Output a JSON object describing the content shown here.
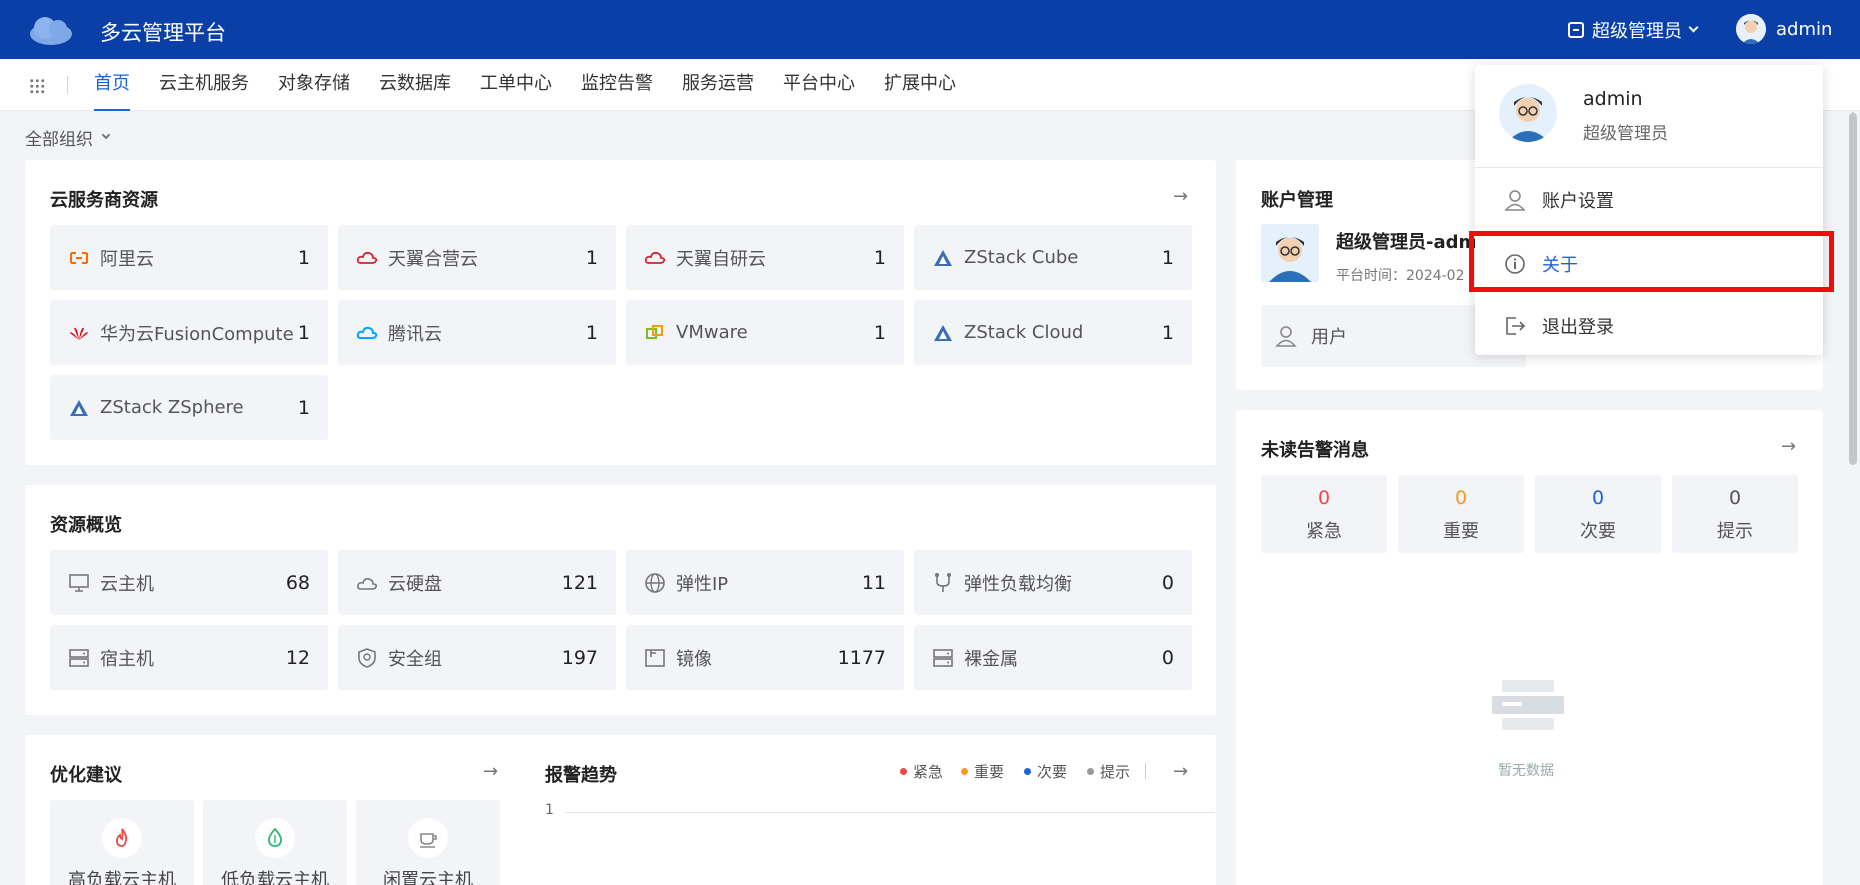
{
  "header": {
    "app_title": "多云管理平台",
    "role_label": "超级管理员",
    "username": "admin"
  },
  "nav": {
    "items": [
      "首页",
      "云主机服务",
      "对象存储",
      "云数据库",
      "工单中心",
      "监控告警",
      "服务运营",
      "平台中心",
      "扩展中心"
    ],
    "active_index": 0
  },
  "org_filter": {
    "label": "全部组织"
  },
  "cloud_resources": {
    "title": "云服务商资源",
    "items": [
      {
        "label": "阿里云",
        "value": "1",
        "icon": "aliyun-icon"
      },
      {
        "label": "天翼合营云",
        "value": "1",
        "icon": "tianyi-cloud-icon"
      },
      {
        "label": "天翼自研云",
        "value": "1",
        "icon": "tianyi-cloud-icon"
      },
      {
        "label": "ZStack Cube",
        "value": "1",
        "icon": "zstack-icon"
      },
      {
        "label": "华为云FusionCompute",
        "value": "1",
        "icon": "huawei-icon"
      },
      {
        "label": "腾讯云",
        "value": "1",
        "icon": "tencent-cloud-icon"
      },
      {
        "label": "VMware",
        "value": "1",
        "icon": "vmware-icon"
      },
      {
        "label": "ZStack Cloud",
        "value": "1",
        "icon": "zstack-icon"
      },
      {
        "label": "ZStack ZSphere",
        "value": "1",
        "icon": "zstack-icon"
      }
    ]
  },
  "resource_overview": {
    "title": "资源概览",
    "items": [
      {
        "label": "云主机",
        "value": "68",
        "icon": "monitor-icon"
      },
      {
        "label": "云硬盘",
        "value": "121",
        "icon": "cloud-disk-icon"
      },
      {
        "label": "弹性IP",
        "value": "11",
        "icon": "globe-icon"
      },
      {
        "label": "弹性负载均衡",
        "value": "0",
        "icon": "load-balancer-icon"
      },
      {
        "label": "宿主机",
        "value": "12",
        "icon": "server-icon"
      },
      {
        "label": "安全组",
        "value": "197",
        "icon": "shield-icon"
      },
      {
        "label": "镜像",
        "value": "1177",
        "icon": "image-icon"
      },
      {
        "label": "裸金属",
        "value": "0",
        "icon": "server-icon"
      }
    ]
  },
  "optimization": {
    "title": "优化建议",
    "items": [
      {
        "label": "高负载云主机",
        "icon": "flame-icon"
      },
      {
        "label": "低负载云主机",
        "icon": "drop-icon"
      },
      {
        "label": "闲置云主机",
        "icon": "cup-icon"
      }
    ]
  },
  "alarm_trend": {
    "title": "报警趋势",
    "legend": [
      {
        "label": "紧急",
        "color": "#f04747"
      },
      {
        "label": "重要",
        "color": "#f59a23"
      },
      {
        "label": "次要",
        "color": "#1d63d8"
      },
      {
        "label": "提示",
        "color": "#999999"
      }
    ],
    "y_tick": "1"
  },
  "account": {
    "title": "账户管理",
    "name": "超级管理员-adm",
    "platform_time": "平台时间：2024-02",
    "user_label": "用户"
  },
  "alerts": {
    "title": "未读告警消息",
    "items": [
      {
        "label": "紧急",
        "count": "0",
        "color": "#f04747"
      },
      {
        "label": "重要",
        "count": "0",
        "color": "#f59a23"
      },
      {
        "label": "次要",
        "count": "0",
        "color": "#1d63d8"
      },
      {
        "label": "提示",
        "count": "0",
        "color": "#555555"
      }
    ],
    "empty_text": "暂无数据"
  },
  "user_menu": {
    "name": "admin",
    "role": "超级管理员",
    "items": [
      {
        "label": "账户设置",
        "icon": "user-icon"
      },
      {
        "label": "关于",
        "icon": "info-icon"
      },
      {
        "label": "退出登录",
        "icon": "logout-icon"
      }
    ]
  }
}
